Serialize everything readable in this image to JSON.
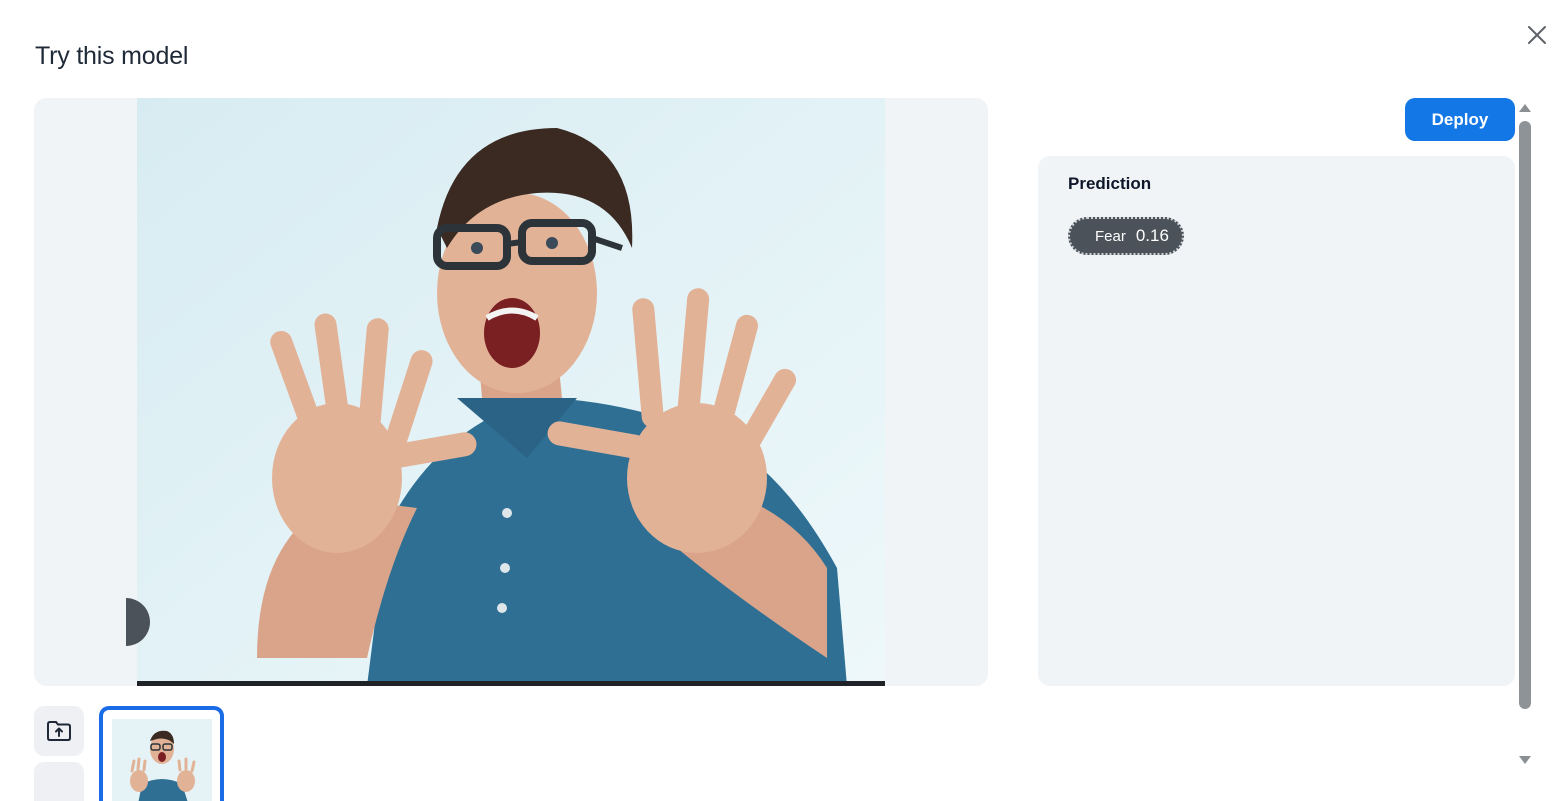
{
  "dialog": {
    "title": "Try this model",
    "close_icon": "close-icon"
  },
  "toolbar": {
    "deploy_label": "Deploy"
  },
  "prediction": {
    "heading": "Prediction",
    "results": [
      {
        "label": "Fear",
        "score": "0.16"
      }
    ]
  },
  "gallery": {
    "upload_icon": "folder-upload-icon",
    "selected_index": 0
  },
  "colors": {
    "accent": "#1377e6",
    "chip_bg": "#4b5259",
    "panel_bg": "#f1f4f7"
  }
}
